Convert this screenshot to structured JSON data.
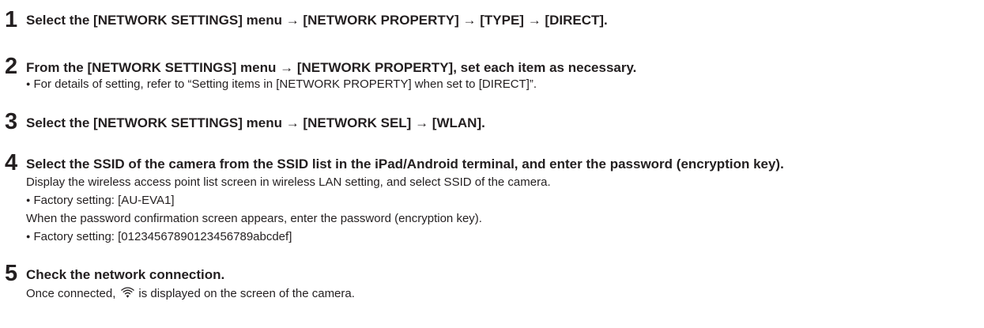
{
  "steps": [
    {
      "number": "1",
      "title": "Select the [NETWORK SETTINGS] menu → [NETWORK PROPERTY] → [TYPE] → [DIRECT]."
    },
    {
      "number": "2",
      "title": "From the [NETWORK SETTINGS] menu → [NETWORK PROPERTY], set each item as necessary.",
      "bullet": "For details of setting, refer to “Setting items in [NETWORK PROPERTY] when set to [DIRECT]”."
    },
    {
      "number": "3",
      "title": "Select the [NETWORK SETTINGS] menu → [NETWORK SEL] → [WLAN]."
    },
    {
      "number": "4",
      "title": "Select the SSID of the camera from the SSID list in the iPad/Android terminal, and enter the password (encryption key).",
      "text1": "Display the wireless access point list screen in wireless LAN setting, and select SSID of the camera.",
      "bullet1": "Factory setting: [AU-EVA1]",
      "text2": "When the password confirmation screen appears, enter the password (encryption key).",
      "bullet2": "Factory setting: [01234567890123456789abcdef]"
    },
    {
      "number": "5",
      "title": "Check the network connection.",
      "text_before_icon": "Once connected,",
      "icon": "wifi-icon",
      "text_after_icon": "is displayed on the screen of the camera."
    }
  ]
}
